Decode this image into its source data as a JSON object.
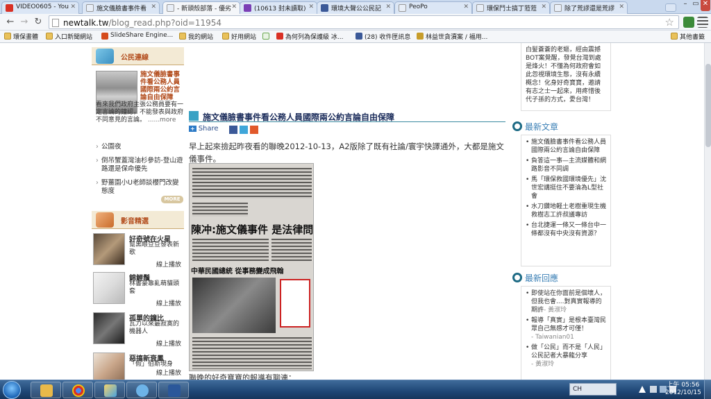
{
  "browser": {
    "tabs": [
      {
        "label": "VIDEO0605 - You",
        "favicon_color": "#d93025"
      },
      {
        "label": "施文儀臉書事件看",
        "favicon_color": "#e8eef7"
      },
      {
        "label": "- 新頭殼部落 - 優劣",
        "favicon_color": "#e8eef7"
      },
      {
        "label": "(10613 封未讀取)",
        "favicon_color": "#7b3fb5"
      },
      {
        "label": "環境大聲公公民記",
        "favicon_color": "#3b5998"
      },
      {
        "label": "PeoPo",
        "favicon_color": "#e8eef7"
      },
      {
        "label": "環保鬥士搞丁蒞蒞",
        "favicon_color": "#e8eef7"
      },
      {
        "label": "除了荒謬還是荒謬",
        "favicon_color": "#e8eef7"
      }
    ],
    "window_controls": [
      "–",
      "▭",
      "✕"
    ],
    "url": {
      "host": "newtalk.tw",
      "path": "/blog_read.php?oid=11954"
    },
    "bookmarks": [
      {
        "label": "環保畫體",
        "icon": "folder-icon"
      },
      {
        "label": "入口新聞網站",
        "icon": "folder-icon"
      },
      {
        "label": "SlideShare Engine...",
        "icon": "slideshare-icon"
      },
      {
        "label": "我的網站",
        "icon": "folder-icon"
      },
      {
        "label": "好用網站",
        "icon": "folder-icon"
      },
      {
        "label": "為何列為保護級 冰...",
        "icon": "youtube-icon"
      },
      {
        "label": "(28) 收件匣訊息",
        "icon": "facebook-icon"
      },
      {
        "label": "林益世貪瀆案 / 福用...",
        "icon": "bookmark-icon"
      }
    ],
    "other_bookmarks": "其他書籤"
  },
  "left": {
    "citizen_section_title": "公民連線",
    "feature": {
      "title": "施文儀臉書事件看公務人員國際兩公約言論自由保障",
      "body": "看來我們政府主張公務員要有一定言論的鐘認，不能發表與政府不同意見的言論。",
      "more": "......more"
    },
    "list": [
      "公園夜",
      "倒吊蟹蓋灣油杉參訪-登山遊路還是保命優先",
      "野薑園小U老師談櫻門改變態度"
    ],
    "more_button": "MORE",
    "video_section_title": "影音精選",
    "videos": [
      {
        "title": "好奇號在火星",
        "sub": "幫黑眼豆豆發表新歌",
        "play": "線上播放"
      },
      {
        "title": "錦鯉鬚",
        "sub": "林書豪靠亂萌貓頭套",
        "play": "線上播放"
      },
      {
        "title": "孤單的鐘比",
        "sub": "瓦力以來最寂寞的機器人",
        "play": "線上播放"
      },
      {
        "title": "惡搞新衰鳳",
        "sub": "「假」伯斯現身",
        "play": "線上播放"
      }
    ]
  },
  "article": {
    "title": "施文儀臉書事件看公務人員國際兩公約言論自由保障",
    "share_label": "Share",
    "para1": "早上起來撿起昨夜看的聯晚2012-10-13，A2版除了既有社論/寰宇快譯通外，大都是施文儀事件。",
    "newspaper_headline1": "陳冲:施文儀事件 是法律問題",
    "newspaper_headline2": "中華民國總統 從事務變成飛翰",
    "tail": "聯晚的好奇寶寶的報導有聊連："
  },
  "right": {
    "top_box": "白髮蒼蒼的老嫗，經由震撼BOT案覺醒，發覺台灣到處是烽火！不懂為何政府會如此忽視環境生態，沒有永續概念！化身好奇寶寶，邀請有志之士一起來，用疼惜後代子孫的方式，愛台灣！",
    "latest_title": "最新文章",
    "latest": [
      "施文儀臉書事件看公務人員國際兩公約言論自由保障",
      "負答這一事—主流媒體和網路影音不同調",
      "馬「環保救國環境優先」沈世宏講挺住不要淪為L型社會",
      "水刀鑽地軽土老樹重現生機救樹志工許叔議專訪",
      "台北捷運一條又一條台中一條都沒有中央沒有資源？"
    ],
    "replies_title": "最新回應",
    "replies": [
      {
        "text": "即使站在你面前是個壞人，但我也會....對真實報導的期許",
        "name": "- 黃淑玲"
      },
      {
        "text": "報導「真實」是根本臺灣民眾自己無感才可僅！",
        "name": "- Taiwanian01"
      },
      {
        "text": "做「公民」而不是「人民」公民記者大暴龍分享",
        "name": "- 黃淑玲"
      }
    ]
  },
  "taskbar": {
    "ime_label": "CH",
    "time": "上午 05:56",
    "date": "2012/10/15"
  }
}
